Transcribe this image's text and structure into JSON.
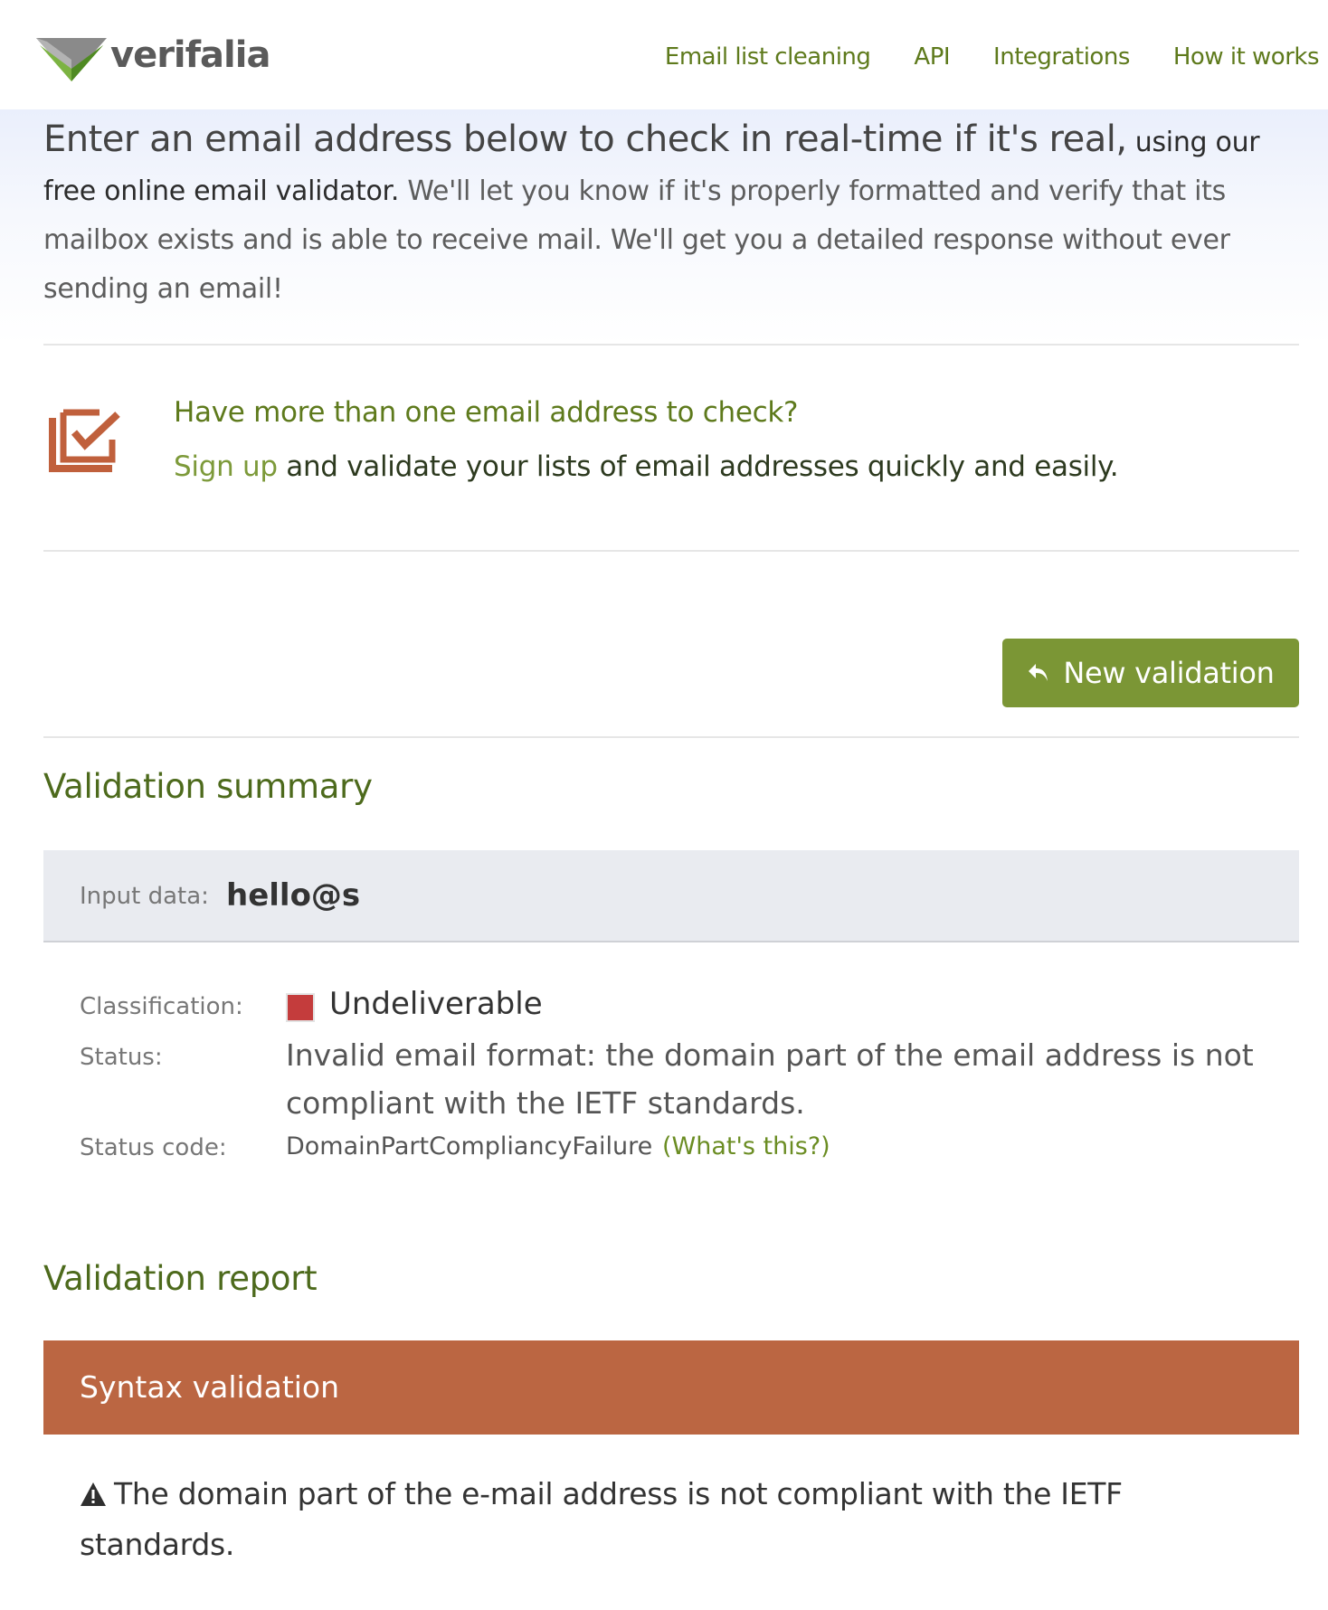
{
  "brand": {
    "name": "verifalia"
  },
  "nav": {
    "items": [
      {
        "label": "Email list cleaning"
      },
      {
        "label": "API"
      },
      {
        "label": "Integrations"
      },
      {
        "label": "How it works"
      }
    ]
  },
  "intro": {
    "lead": "Enter an email address below to check in real-time if it's real,",
    "dark": " using our free online email validator.",
    "rest": " We'll let you know if it's properly formatted and verify that its mailbox exists and is able to receive mail. We'll get you a detailed response without ever sending an email!"
  },
  "signup": {
    "question": "Have more than one email address to check?",
    "link": "Sign up",
    "text": " and validate your lists of email addresses quickly and easily.",
    "icon": "checklist-icon"
  },
  "actions": {
    "new_validation": "New validation",
    "icon": "reply-arrow-icon"
  },
  "summary": {
    "title": "Validation summary",
    "input_label": "Input data:",
    "input_value": "hello@s",
    "classification_label": "Classification:",
    "classification_value": "Undeliverable",
    "classification_color": "#c43c3c",
    "status_label": "Status:",
    "status_value": "Invalid email format: the domain part of the email address is not compliant with the IETF standards.",
    "status_code_label": "Status code:",
    "status_code_value": "DomainPartCompliancyFailure",
    "whats_this": "(What's this?)"
  },
  "report": {
    "title": "Validation report",
    "syntax_title": "Syntax validation",
    "syntax_color": "#bb6642",
    "warning_icon": "warning-icon",
    "warning_text": "The domain part of the e-mail address is not compliant with the IETF standards."
  },
  "colors": {
    "accent": "#7b9635",
    "link": "#5e7a1c"
  }
}
